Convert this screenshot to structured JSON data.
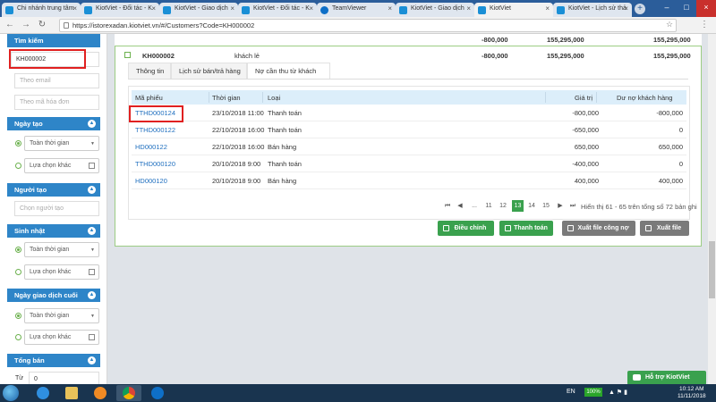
{
  "browser": {
    "tabs": [
      {
        "label": "Chi nhánh trung tâm",
        "icon": "kiotviet-icon",
        "active": false
      },
      {
        "label": "KiotViet - Đối tác - K",
        "icon": "kiotviet-icon",
        "active": false
      },
      {
        "label": "KiotViet - Giao dịch",
        "icon": "kiotviet-icon",
        "active": false
      },
      {
        "label": "KiotViet - Đối tác - K",
        "icon": "kiotviet-icon",
        "active": false
      },
      {
        "label": "TeamViewer",
        "icon": "teamviewer-icon",
        "active": false
      },
      {
        "label": "KiotViet - Giao dịch",
        "icon": "kiotviet-icon",
        "active": false
      },
      {
        "label": "KiotViet",
        "icon": "kiotviet-icon",
        "active": true
      },
      {
        "label": "KiotViet - Lịch sử thả",
        "icon": "kiotviet-icon",
        "active": false
      }
    ],
    "url": "https://istorexadan.kiotviet.vn/#/Customers?Code=KH000002"
  },
  "sidebar": {
    "search_title": "Tìm kiếm",
    "search_value": "KH000002",
    "email_placeholder": "Theo email",
    "invoice_placeholder": "Theo mã hóa đơn",
    "created_date": {
      "title": "Ngày tạo",
      "option1": "Toàn thời gian",
      "option2": "Lựa chọn khác"
    },
    "creator": {
      "title": "Người tạo",
      "placeholder": "Chọn người tạo"
    },
    "birthday": {
      "title": "Sinh nhật",
      "option1": "Toàn thời gian",
      "option2": "Lựa chọn khác"
    },
    "last_transaction": {
      "title": "Ngày giao dịch cuối",
      "option1": "Toàn thời gian",
      "option2": "Lựa chọn khác"
    },
    "total_sales": {
      "title": "Tổng bán",
      "from_label": "Từ",
      "from_value": "0"
    }
  },
  "summary_row": {
    "debt": "-800,000",
    "total1": "155,295,000",
    "total2": "155,295,000"
  },
  "customer": {
    "code": "KH000002",
    "name": "khách lẻ",
    "debt": "-800,000",
    "total1": "155,295,000",
    "total2": "155,295,000"
  },
  "tabs": [
    "Thông tin",
    "Lịch sử bán/trả hàng",
    "Nợ cần thu từ khách"
  ],
  "table": {
    "headers": [
      "Mã phiếu",
      "Thời gian",
      "Loại",
      "Giá trị",
      "Dư nợ khách hàng"
    ],
    "rows": [
      {
        "code": "TTHD000124",
        "time": "23/10/2018 11:00",
        "type": "Thanh toán",
        "value": "-800,000",
        "balance": "-800,000"
      },
      {
        "code": "TTHD000122",
        "time": "22/10/2018 16:00",
        "type": "Thanh toán",
        "value": "-650,000",
        "balance": "0"
      },
      {
        "code": "HD000122",
        "time": "22/10/2018 16:00",
        "type": "Bán hàng",
        "value": "650,000",
        "balance": "650,000"
      },
      {
        "code": "TTHD000120",
        "time": "20/10/2018 9:00",
        "type": "Thanh toán",
        "value": "-400,000",
        "balance": "0"
      },
      {
        "code": "HD000120",
        "time": "20/10/2018 9:00",
        "type": "Bán hàng",
        "value": "400,000",
        "balance": "400,000"
      }
    ]
  },
  "pagination": {
    "first": "⏮",
    "prev": "◀",
    "ellipsis": "...",
    "pages": [
      "11",
      "12",
      "13",
      "14",
      "15"
    ],
    "current": "13",
    "next": "▶",
    "last": "⏭",
    "info": "Hiển thị 61 - 65 trên tổng số 72 bản ghi"
  },
  "actions": {
    "adjust": "Điều chỉnh",
    "payment": "Thanh toán",
    "export_debt": "Xuất file công nợ",
    "export": "Xuất file"
  },
  "support": "Hỗ trợ KiotViet",
  "taskbar": {
    "language": "EN",
    "battery": "100%",
    "time": "10:12 AM",
    "date": "11/11/2018"
  }
}
